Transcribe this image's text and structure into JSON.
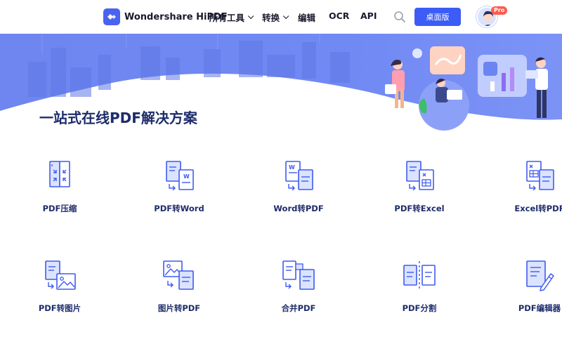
{
  "header": {
    "brand": "Wondershare HiPDF",
    "nav": [
      {
        "label": "所有工具",
        "dropdown": true
      },
      {
        "label": "转换",
        "dropdown": true
      },
      {
        "label": "编辑",
        "dropdown": false
      },
      {
        "label": "OCR",
        "dropdown": false
      },
      {
        "label": "API",
        "dropdown": false
      }
    ],
    "desktop_button": "桌面版",
    "pro_badge": "Pro"
  },
  "main": {
    "section_title": "一站式在线PDF解决方案",
    "tools": [
      {
        "label": "PDF压缩",
        "icon": "compress-pdf-icon"
      },
      {
        "label": "PDF转Word",
        "icon": "pdf-to-word-icon"
      },
      {
        "label": "Word转PDF",
        "icon": "word-to-pdf-icon"
      },
      {
        "label": "PDF转Excel",
        "icon": "pdf-to-excel-icon"
      },
      {
        "label": "Excel转PDF",
        "icon": "excel-to-pdf-icon"
      },
      {
        "label": "PDF转图片",
        "icon": "pdf-to-image-icon"
      },
      {
        "label": "图片转PDF",
        "icon": "image-to-pdf-icon"
      },
      {
        "label": "合并PDF",
        "icon": "merge-pdf-icon"
      },
      {
        "label": "PDF分割",
        "icon": "split-pdf-icon"
      },
      {
        "label": "PDF编辑器",
        "icon": "pdf-editor-icon"
      }
    ]
  },
  "colors": {
    "accent": "#3c5cf5",
    "hero": "#6b84f2",
    "icon_stroke": "#3f5bf0",
    "icon_fill": "#dbe3ff",
    "text_dark": "#1d2c6b"
  }
}
